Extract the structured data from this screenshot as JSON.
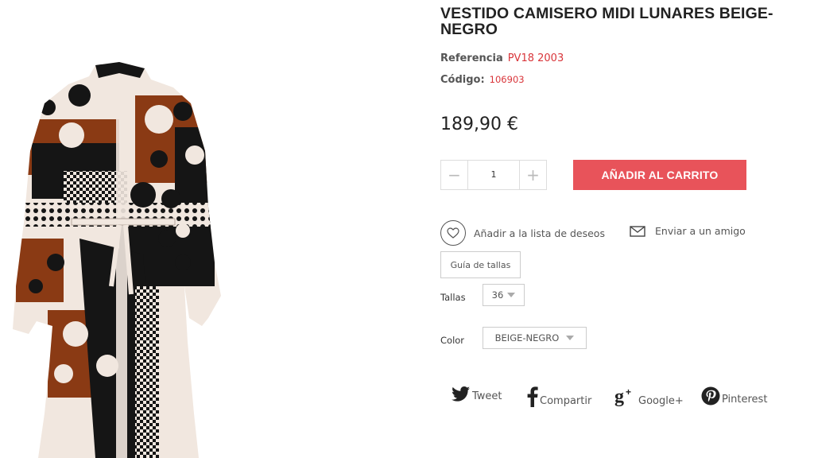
{
  "product": {
    "title": "VESTIDO CAMISERO MIDI LUNARES BEIGE-NEGRO",
    "reference_label": "Referencia",
    "reference_value": "PV18 2003",
    "code_label": "Código:",
    "code_value": "106903",
    "price": "189,90 €"
  },
  "quantity": {
    "minus": "−",
    "plus": "+",
    "value": "1"
  },
  "cart_button": "AÑADIR AL CARRITO",
  "wishlist_label": "Añadir a la lista de deseos",
  "send_friend_label": "Enviar a un amigo",
  "size_guide_label": "Guía de tallas",
  "options": {
    "size_label": "Tallas",
    "size_value": "36",
    "color_label": "Color",
    "color_value": "BEIGE-NEGRO"
  },
  "share": {
    "tweet": "Tweet",
    "facebook": "Compartir",
    "google": "Google+",
    "pinterest": "Pinterest"
  },
  "colors": {
    "accent": "#e8535a",
    "price_red": "#d9353a",
    "dress_black": "#151515",
    "dress_brown": "#8a3a14",
    "dress_beige": "#f1e7df"
  },
  "icons": [
    "heart-icon",
    "envelope-icon",
    "twitter-icon",
    "facebook-icon",
    "google-plus-icon",
    "pinterest-icon"
  ]
}
